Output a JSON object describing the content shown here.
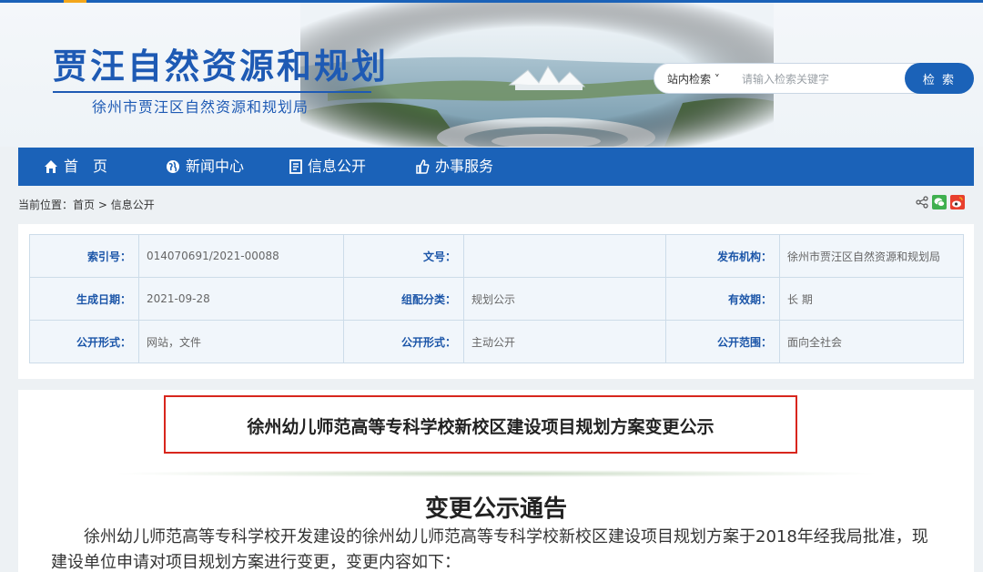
{
  "site": {
    "logo_title": "贾汪自然资源和规划",
    "logo_subtitle": "徐州市贾汪区自然资源和规划局"
  },
  "search": {
    "scope": "站内检索 ˅",
    "placeholder": "请输入检索关键字",
    "button": "检 索"
  },
  "nav": {
    "items": [
      {
        "label": "首　页",
        "icon": "home-icon"
      },
      {
        "label": "新闻中心",
        "icon": "globe-icon"
      },
      {
        "label": "信息公开",
        "icon": "document-icon"
      },
      {
        "label": "办事服务",
        "icon": "thumbs-up-icon"
      }
    ]
  },
  "breadcrumb": {
    "prefix": "当前位置：",
    "home": "首页",
    "sep": " > ",
    "current": "信息公开"
  },
  "share_icons": [
    "share-icon",
    "wechat-icon",
    "weibo-icon"
  ],
  "info": {
    "rows": [
      [
        {
          "label": "索引号：",
          "value": "014070691/2021-00088"
        },
        {
          "label": "文号：",
          "value": ""
        },
        {
          "label": "发布机构：",
          "value": "徐州市贾汪区自然资源和规划局"
        }
      ],
      [
        {
          "label": "生成日期：",
          "value": "2021-09-28"
        },
        {
          "label": "组配分类：",
          "value": "规划公示"
        },
        {
          "label": "有效期：",
          "value": "长 期"
        }
      ],
      [
        {
          "label": "公开形式：",
          "value": "网站，文件"
        },
        {
          "label": "公开形式：",
          "value": "主动公开"
        },
        {
          "label": "公开范围：",
          "value": "面向全社会"
        }
      ]
    ]
  },
  "content": {
    "doc_title": "徐州幼儿师范高等专科学校新校区建设项目规划方案变更公示",
    "notice_title": "变更公示通告",
    "body": "徐州幼儿师范高等专科学校开发建设的徐州幼儿师范高等专科学校新校区建设项目规划方案于2018年经我局批准，现建设单位申请对项目规划方案进行变更，变更内容如下："
  },
  "colors": {
    "primary": "#1b62b8",
    "highlight_border": "#d8261d",
    "accent": "#f3a61b"
  }
}
